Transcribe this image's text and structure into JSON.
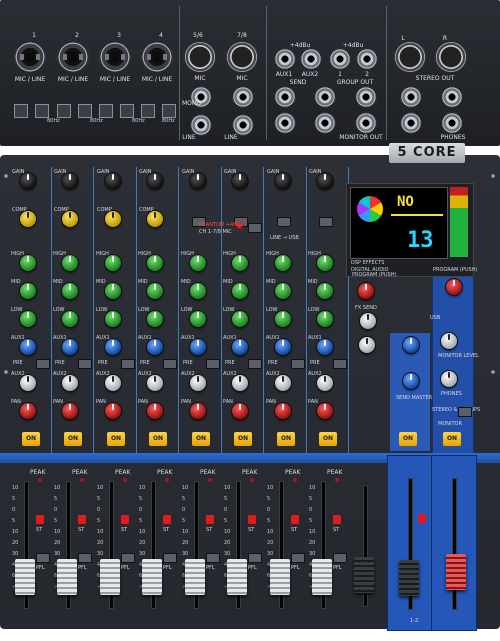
{
  "brand": "5 CORE",
  "top_labels": {
    "mic_line": "MIC / LINE",
    "ch1": "1",
    "ch2": "2",
    "ch3": "3",
    "ch4": "4",
    "ch56": "5/6",
    "ch78": "7/8",
    "mic": "MIC",
    "mono": "MONO",
    "line": "LINE",
    "aux1": "AUX1",
    "aux2": "AUX2",
    "send": "SEND",
    "group_out": "GROUP OUT",
    "stereo_out": "STEREO OUT",
    "monitor_out": "MONITOR OUT",
    "phones": "PHONES",
    "l": "L",
    "r": "R",
    "two": "2",
    "one": "1",
    "db": "+4dBu",
    "pad_48v": "PAD",
    "hz": "80Hz"
  },
  "strip_labels": {
    "gain": "GAIN",
    "comp": "COMP",
    "high": "HIGH",
    "mid": "MID",
    "low": "LOW",
    "aux1": "AUX1",
    "aux2": "AUX2",
    "pre": "PRE",
    "pan": "PAN",
    "on": "ON",
    "peak": "PEAK",
    "pfl": "PFL",
    "st": "ST"
  },
  "center_labels": {
    "phantom": "PHANTOM +48V",
    "ch_range": "CH 1-7/8 MIC",
    "hpf": "HPF",
    "line_usb": "LINE → USB",
    "dsp": "DSP EFFECTS",
    "digital_audio": "DIGITAL AUDIO",
    "program_push": "PROGRAM (PUSH)",
    "fx_send": "FX SEND",
    "usb": "USB",
    "send_master": "SEND MASTER",
    "monitor_level": "MONITOR LEVEL",
    "phones": "PHONES",
    "stereo_group": "STEREO & GROUPS",
    "monitor": "MONITOR",
    "aux": "AUX",
    "fx": "FX",
    "group_12": "1-2"
  },
  "lcd": {
    "top": "NO",
    "number": "13"
  },
  "fader_scale": [
    "10",
    "5",
    "0",
    "5",
    "10",
    "20",
    "30",
    "40",
    "60",
    "∞"
  ],
  "colors": {
    "accent_blue": "#2457b8",
    "on_yellow": "#f0b400",
    "lcd_green": "#f5e13a",
    "lcd_cyan": "#2fd3ff"
  }
}
